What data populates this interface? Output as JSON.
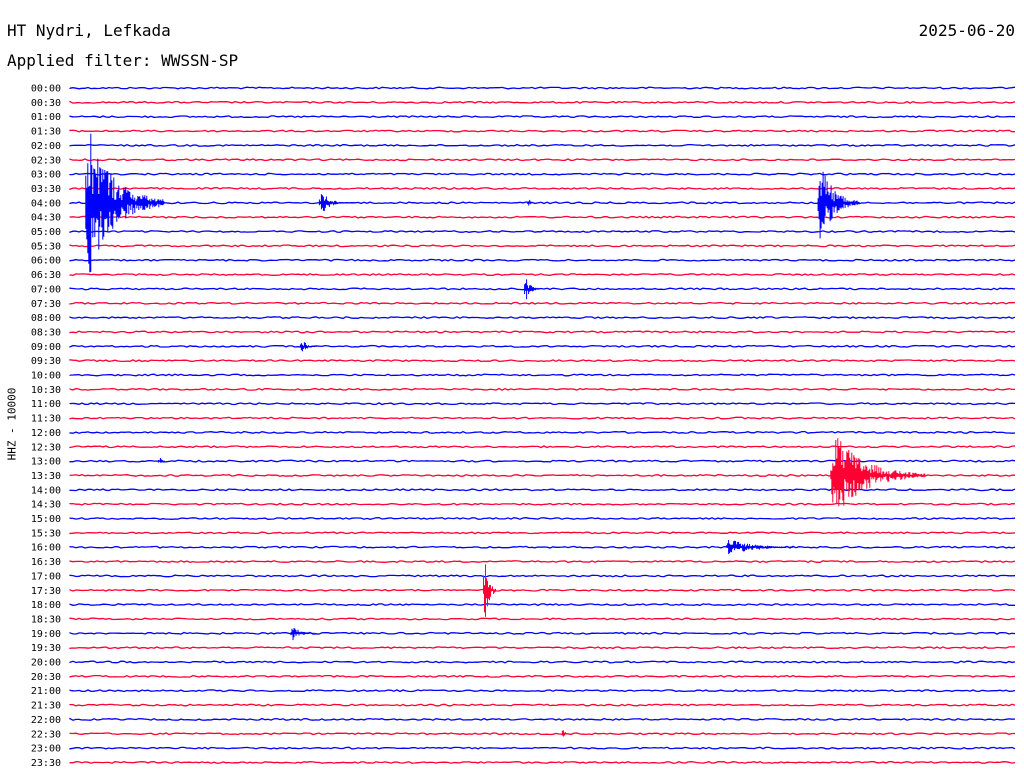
{
  "header": {
    "station": "HT Nydri, Lefkada",
    "date": "2025-06-20",
    "filter": "Applied filter: WWSSN-SP"
  },
  "chart_data": {
    "type": "line",
    "title": "HT Nydri, Lefkada",
    "subtitle": "Applied filter: WWSSN-SP",
    "date": "2025-06-20",
    "ylabel": "HHZ - 10000",
    "xlabel": "",
    "row_minutes": 30,
    "colors": [
      "#0000ff",
      "#ff0033"
    ],
    "rows": [
      "00:00",
      "00:30",
      "01:00",
      "01:30",
      "02:00",
      "02:30",
      "03:00",
      "03:30",
      "04:00",
      "04:30",
      "05:00",
      "05:30",
      "06:00",
      "06:30",
      "07:00",
      "07:30",
      "08:00",
      "08:30",
      "09:00",
      "09:30",
      "10:00",
      "10:30",
      "11:00",
      "11:30",
      "12:00",
      "12:30",
      "13:00",
      "13:30",
      "14:00",
      "14:30",
      "15:00",
      "15:30",
      "16:00",
      "16:30",
      "17:00",
      "17:30",
      "18:00",
      "18:30",
      "19:00",
      "19:30",
      "20:00",
      "20:30",
      "21:00",
      "21:30",
      "22:00",
      "22:30",
      "23:00",
      "23:30"
    ],
    "events": [
      {
        "row": "04:00",
        "minute": 0.5,
        "amplitude": "very large",
        "duration_min": 2.5
      },
      {
        "row": "04:00",
        "minute": 7.9,
        "amplitude": "medium",
        "duration_min": 0.8
      },
      {
        "row": "04:00",
        "minute": 14.5,
        "amplitude": "small",
        "duration_min": 0.2
      },
      {
        "row": "04:00",
        "minute": 23.7,
        "amplitude": "large",
        "duration_min": 1.3
      },
      {
        "row": "07:00",
        "minute": 14.4,
        "amplitude": "medium",
        "duration_min": 0.5
      },
      {
        "row": "09:00",
        "minute": 7.3,
        "amplitude": "small",
        "duration_min": 0.6
      },
      {
        "row": "13:00",
        "minute": 2.8,
        "amplitude": "small",
        "duration_min": 0.2
      },
      {
        "row": "13:30",
        "minute": 24.1,
        "amplitude": "large",
        "duration_min": 3.0
      },
      {
        "row": "16:00",
        "minute": 20.8,
        "amplitude": "small",
        "duration_min": 2.5
      },
      {
        "row": "17:30",
        "minute": 13.1,
        "amplitude": "large",
        "duration_min": 0.4
      },
      {
        "row": "19:00",
        "minute": 7.0,
        "amplitude": "small",
        "duration_min": 0.8
      },
      {
        "row": "22:30",
        "minute": 15.6,
        "amplitude": "small",
        "duration_min": 0.2
      }
    ]
  }
}
